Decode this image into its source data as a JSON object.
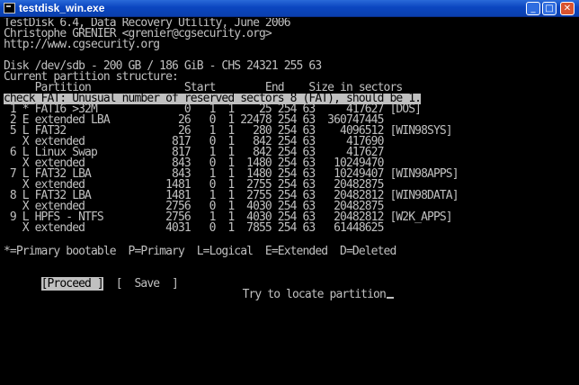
{
  "window": {
    "title": "testdisk_win.exe",
    "minimize_glyph": "_",
    "maximize_glyph": "□",
    "close_glyph": "✕"
  },
  "console": {
    "header": [
      "TestDisk 6.4, Data Recovery Utility, June 2006",
      "Christophe GRENIER <grenier@cgsecurity.org>",
      "http://www.cgsecurity.org"
    ],
    "disk_line": "Disk /dev/sdb - 200 GB / 186 GiB - CHS 24321 255 63",
    "structure_label": "Current partition structure:",
    "columns_line": "     Partition               Start        End    Size in sectors",
    "warning": "check_FAT: Unusual number of reserved sectors 8 (FAT), should be 1.",
    "partitions": [
      " 1 * FAT16 >32M              0   1  1    25 254 63     417627 [DOS]",
      " 2 E extended LBA           26   0  1 22478 254 63  360747445",
      " 5 L FAT32                  26   1  1   280 254 63    4096512 [WIN98SYS]",
      "   X extended              817   0  1   842 254 63     417690",
      " 6 L Linux Swap            817   1  1   842 254 63     417627",
      "   X extended              843   0  1  1480 254 63   10249470",
      " 7 L FAT32 LBA             843   1  1  1480 254 63   10249407 [WIN98APPS]",
      "   X extended             1481   0  1  2755 254 63   20482875",
      " 8 L FAT32 LBA            1481   1  1  2755 254 63   20482812 [WIN98DATA]",
      "   X extended             2756   0  1  4030 254 63   20482875",
      " 9 L HPFS - NTFS          2756   1  1  4030 254 63   20482812 [W2K_APPS]",
      "   X extended             4031   0  1  7855 254 63   61448625"
    ],
    "legend": "*=Primary bootable  P=Primary  L=Logical  E=Extended  D=Deleted",
    "actions": {
      "proceed": "[Proceed ]",
      "save": "[  Save  ]"
    },
    "status": "Try to locate partition"
  }
}
